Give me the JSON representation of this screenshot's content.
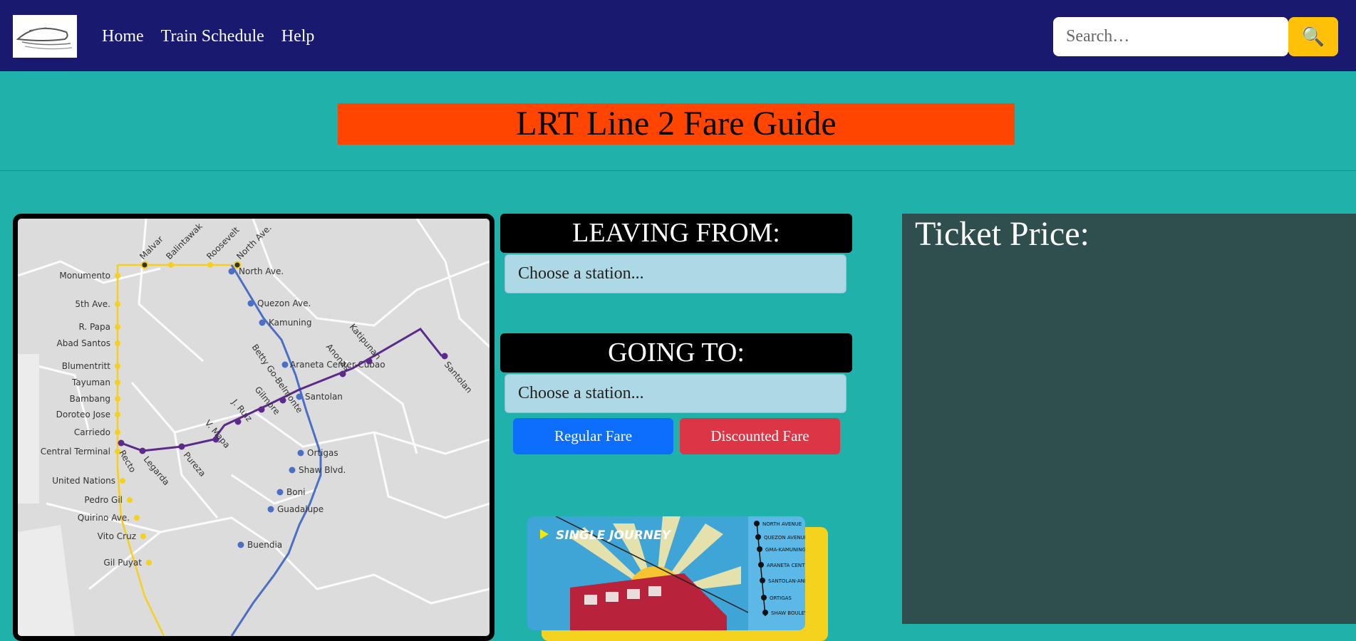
{
  "nav": {
    "links": [
      "Home",
      "Train Schedule",
      "Help"
    ],
    "search_placeholder": "Search…"
  },
  "title": "LRT Line 2 Fare Guide",
  "form": {
    "leaving_label": "LEAVING FROM:",
    "going_label": "GOING TO:",
    "leaving_value": "Choose a station...",
    "going_value": "Choose a station...",
    "regular_button": "Regular Fare",
    "discount_button": "Discounted Fare"
  },
  "ticket_price_label": "Ticket Price:",
  "map": {
    "yellow_top_stations": [
      "Malvar",
      "Balintawak",
      "Roosevelt",
      "North Ave."
    ],
    "yellow_left_stations": [
      "Monumento",
      "5th Ave.",
      "R. Papa",
      "Abad Santos",
      "Blumentritt",
      "Tayuman",
      "Bambang",
      "Doroteo Jose",
      "Carriedo",
      "Central Terminal",
      "United Nations",
      "Pedro Gil",
      "Quirino Ave.",
      "Vito Cruz",
      "Gil Puyat"
    ],
    "blue_stations": [
      "North Ave.",
      "Quezon Ave.",
      "Kamuning",
      "Araneta Center-Cubao",
      "Santolan",
      "Ortigas",
      "Shaw Blvd.",
      "Boni",
      "Guadalupe",
      "Buendia"
    ],
    "purple_stations": [
      "Recto",
      "Legarda",
      "Pureza",
      "V. Mapa",
      "J. Ruiz",
      "Gilmore",
      "Betty Go-Belmonte",
      "Anonas",
      "Katipunan",
      "Santolan"
    ]
  },
  "ticket_card": {
    "heading": "SINGLE JOURNEY",
    "stations": [
      "NORTH AVENUE",
      "QUEZON AVENUE",
      "GMA-KAMUNING",
      "ARANETA CENTER-CUBAO",
      "SANTOLAN-ANNAPOLIS",
      "ORTIGAS",
      "SHAW BOULEVARD"
    ]
  },
  "colors": {
    "navbar": "#191970",
    "page_bg": "#20b2aa",
    "title_bg": "#ff4500",
    "search_button": "#ffc107",
    "price_panel": "#2f4f4f",
    "regular_button": "#0d6efd",
    "discount_button": "#dc3545",
    "select_bg": "#add8e6"
  },
  "icons": [
    "train-logo-icon",
    "search-icon"
  ]
}
